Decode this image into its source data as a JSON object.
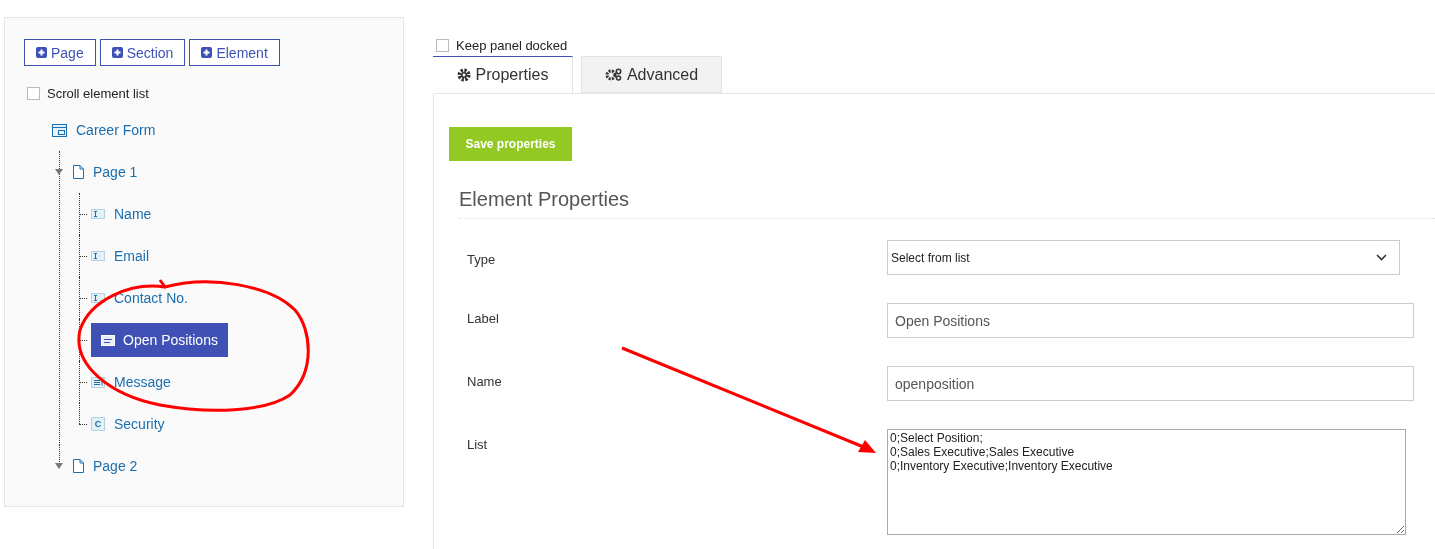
{
  "toolbar": {
    "buttons": [
      {
        "label": "Page"
      },
      {
        "label": "Section"
      },
      {
        "label": "Element"
      }
    ]
  },
  "scroll_option": {
    "label": "Scroll element list",
    "checked": false
  },
  "tree": {
    "label": "Career Form",
    "kind": "form",
    "selected": false,
    "children": [
      {
        "label": "Page 1",
        "kind": "page",
        "expanded": true,
        "selected": false,
        "children": [
          {
            "label": "Name",
            "kind": "text",
            "selected": false
          },
          {
            "label": "Email",
            "kind": "text",
            "selected": false
          },
          {
            "label": "Contact No.",
            "kind": "text",
            "selected": false
          },
          {
            "label": "Open Positions",
            "kind": "select",
            "selected": true
          },
          {
            "label": "Message",
            "kind": "textarea",
            "selected": false
          },
          {
            "label": "Security",
            "kind": "captcha",
            "badge": "C",
            "selected": false
          }
        ]
      },
      {
        "label": "Page 2",
        "kind": "page",
        "expanded": true,
        "selected": false
      }
    ]
  },
  "dock_option": {
    "label": "Keep panel docked",
    "checked": false
  },
  "tabs": [
    {
      "label": "Properties",
      "kind": "gear",
      "selected": true
    },
    {
      "label": "Advanced",
      "kind": "gears",
      "selected": false
    }
  ],
  "save_button": "Save properties",
  "section_title": "Element Properties",
  "fields": [
    {
      "label": "Type",
      "kind": "select",
      "value": "Select from list"
    },
    {
      "label": "Label",
      "kind": "input",
      "value": "Open Positions"
    },
    {
      "label": "Name",
      "kind": "input",
      "value": "openposition"
    },
    {
      "label": "List",
      "kind": "textarea",
      "value": "0;Select Position;\n0;Sales Executive;Sales Executive\n0;Inventory Executive;Inventory Executive"
    }
  ],
  "annotation_circle": {
    "color": "#ff0000"
  },
  "annotation_arrow": {
    "color": "#ff0000"
  }
}
